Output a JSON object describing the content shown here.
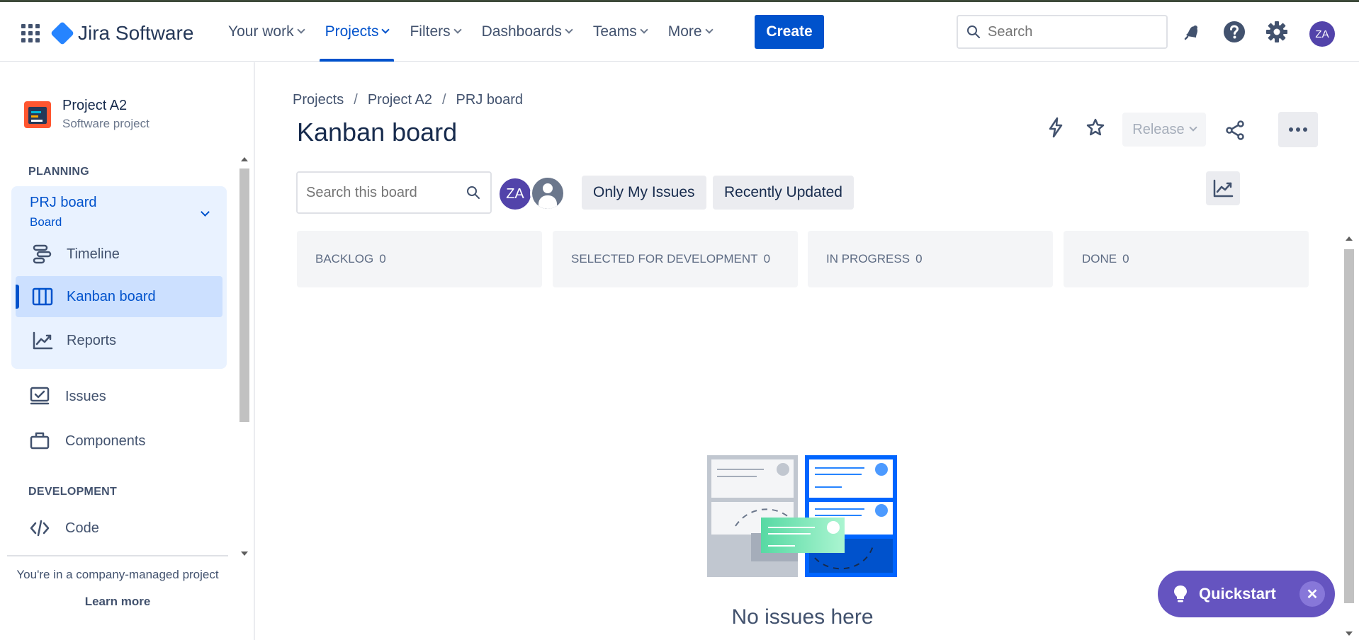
{
  "topnav": {
    "product_name": "Jira Software",
    "items": [
      {
        "label": "Your work"
      },
      {
        "label": "Projects"
      },
      {
        "label": "Filters"
      },
      {
        "label": "Dashboards"
      },
      {
        "label": "Teams"
      },
      {
        "label": "More"
      }
    ],
    "active_item": "Projects",
    "create_label": "Create",
    "search_placeholder": "Search",
    "user_initials": "ZA"
  },
  "sidebar": {
    "project_name": "Project A2",
    "project_type": "Software project",
    "planning_label": "PLANNING",
    "board_name": "PRJ board",
    "board_sub": "Board",
    "planning_items": [
      {
        "label": "Timeline",
        "icon": "timeline-icon"
      },
      {
        "label": "Kanban board",
        "icon": "kanban-board-icon",
        "active": true
      },
      {
        "label": "Reports",
        "icon": "reports-icon"
      }
    ],
    "other_items": [
      {
        "label": "Issues",
        "icon": "issues-icon"
      },
      {
        "label": "Components",
        "icon": "components-icon"
      }
    ],
    "development_label": "DEVELOPMENT",
    "dev_items": [
      {
        "label": "Code",
        "icon": "code-icon"
      }
    ],
    "footer_note": "You're in a company-managed project",
    "learn_more": "Learn more"
  },
  "main": {
    "breadcrumb": [
      "Projects",
      "Project A2",
      "PRJ board"
    ],
    "title": "Kanban board",
    "release_label": "Release",
    "board_search_placeholder": "Search this board",
    "assignee_initials": "ZA",
    "filters": [
      "Only My Issues",
      "Recently Updated"
    ],
    "columns": [
      {
        "name": "BACKLOG",
        "count": "0"
      },
      {
        "name": "SELECTED FOR DEVELOPMENT",
        "count": "0"
      },
      {
        "name": "IN PROGRESS",
        "count": "0"
      },
      {
        "name": "DONE",
        "count": "0"
      }
    ],
    "empty_text": "No issues here"
  },
  "quickstart": {
    "label": "Quickstart"
  },
  "colors": {
    "brand_blue": "#0052cc",
    "active_bg": "#cce0ff",
    "quickstart": "#6554c0",
    "avatar": "#5243aa"
  }
}
